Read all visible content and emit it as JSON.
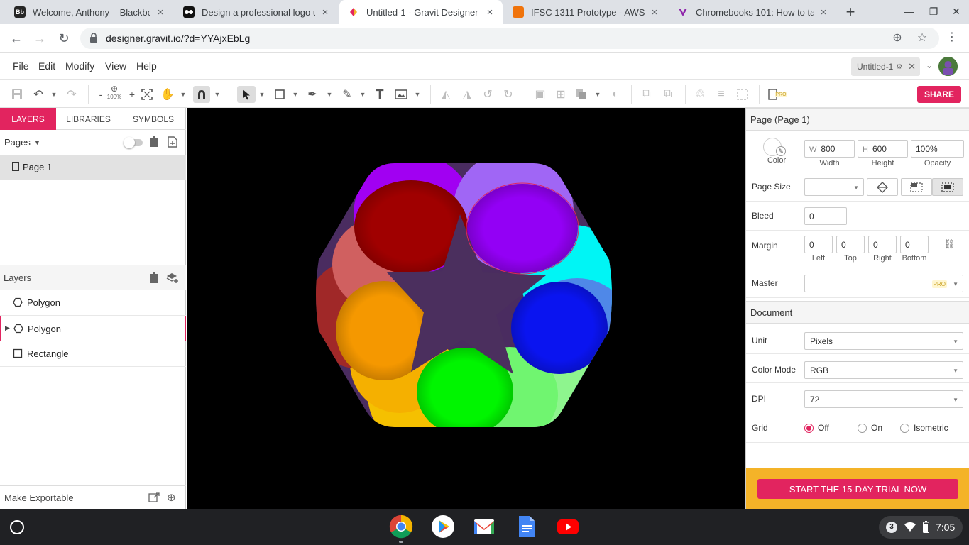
{
  "browser": {
    "tabs": [
      {
        "title": "Welcome, Anthony – Blackbo",
        "favicon": "Bb",
        "favicon_color": "#262626",
        "active": false
      },
      {
        "title": "Design a professional logo us",
        "favicon": "",
        "favicon_color": "#1dbf73",
        "active": false
      },
      {
        "title": "Untitled-1 - Gravit Designer",
        "favicon": "",
        "favicon_color": "#e2245f",
        "active": true
      },
      {
        "title": "IFSC 1311 Prototype - AWS C",
        "favicon": "",
        "favicon_color": "#f0730b",
        "active": false
      },
      {
        "title": "Chromebooks 101: How to ta",
        "favicon": "",
        "favicon_color": "#8e24aa",
        "active": false
      }
    ],
    "url": "designer.gravit.io/?d=YYAjxEbLg"
  },
  "menu": {
    "items": [
      "File",
      "Edit",
      "Modify",
      "View",
      "Help"
    ],
    "doc_tab": "Untitled-1"
  },
  "toolbar": {
    "zoom_label": "100%",
    "share_label": "SHARE",
    "pro_label": "PRO"
  },
  "left": {
    "tabs": [
      "LAYERS",
      "LIBRARIES",
      "SYMBOLS"
    ],
    "pages_title": "Pages",
    "pages": [
      "Page 1"
    ],
    "layers_title": "Layers",
    "layers": [
      {
        "name": "Polygon",
        "type": "polygon",
        "selected": false,
        "expandable": false
      },
      {
        "name": "Polygon",
        "type": "polygon",
        "selected": true,
        "expandable": true
      },
      {
        "name": "Rectangle",
        "type": "rectangle",
        "selected": false,
        "expandable": false
      }
    ],
    "export_label": "Make Exportable"
  },
  "inspector": {
    "page_title": "Page (Page 1)",
    "color_label": "Color",
    "width_prefix": "W",
    "width_value": "800",
    "width_label": "Width",
    "height_prefix": "H",
    "height_value": "600",
    "height_label": "Height",
    "opacity_value": "100%",
    "opacity_label": "Opacity",
    "page_size_label": "Page Size",
    "page_size_value": "",
    "bleed_label": "Bleed",
    "bleed_value": "0",
    "margin_label": "Margin",
    "margins": [
      {
        "value": "0",
        "label": "Left"
      },
      {
        "value": "0",
        "label": "Top"
      },
      {
        "value": "0",
        "label": "Right"
      },
      {
        "value": "0",
        "label": "Bottom"
      }
    ],
    "master_label": "Master",
    "master_badge": "PRO",
    "document_title": "Document",
    "unit_label": "Unit",
    "unit_value": "Pixels",
    "color_mode_label": "Color Mode",
    "color_mode_value": "RGB",
    "dpi_label": "DPI",
    "dpi_value": "72",
    "grid_label": "Grid",
    "grid_options": [
      "Off",
      "On",
      "Isometric"
    ],
    "grid_selected": "Off",
    "trial_button": "START THE 15-DAY TRIAL NOW"
  },
  "shelf": {
    "apps": [
      "chrome-icon",
      "play-store-icon",
      "gmail-icon",
      "docs-icon",
      "youtube-icon"
    ],
    "notification_count": "3",
    "time": "7:05"
  },
  "colors": {
    "accent": "#e2245f",
    "promo": "#f4b328",
    "canvas_bg": "#000000",
    "star": "#4b2f5e"
  }
}
